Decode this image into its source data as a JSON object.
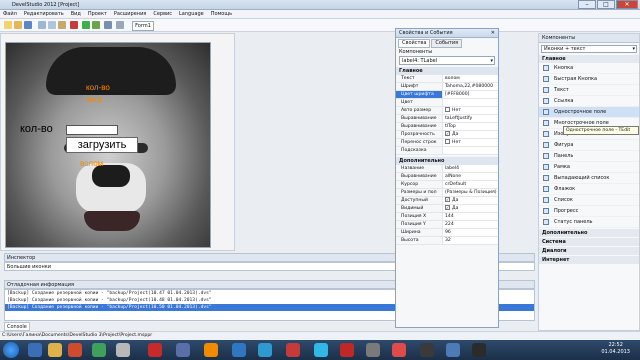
{
  "window": {
    "title": "DevelStudio 2012 [Project]"
  },
  "menu": [
    "Файл",
    "Редактировать",
    "Вид",
    "Проект",
    "Расширения",
    "Сервис",
    "Language",
    "Помощь"
  ],
  "form_tab": "Form1",
  "canvas": {
    "label_text": "кол-во",
    "button_text": "загрузить",
    "orange_label_1": "кол-во",
    "orange_label_2": "загр",
    "orange_label_3": "волом"
  },
  "inspector": {
    "title": "Инспектор",
    "value": "Большие иконки"
  },
  "debug": {
    "title": "Отладочная информация",
    "lines": [
      "[Backup] Создание резервной копии - \"backup/Project(10.47 01.04.2013).dvs\"",
      "[Backup] Создание резервной копии - \"backup/Project(10.48 01.04.2013).dvs\"",
      "[Backup] Создание резервной копии - \"backup/Project(10.50 01.04.2013).dvs\""
    ],
    "console_tab": "Console"
  },
  "path": "C:\\Users\\Галина\\Documents\\DevelStudio 3\\Project\\Project.msppr",
  "props": {
    "title": "Свойства и События",
    "tabs": [
      "Свойства",
      "События"
    ],
    "component_label": "Компоненты",
    "component_value": "label4: TLabel",
    "section_main": "Главное",
    "rows_main": [
      {
        "k": "Текст",
        "v": "волом"
      },
      {
        "k": "Шрифт",
        "v": "Tahoma,22,#080000"
      },
      {
        "k": "Цвет шрифта",
        "v": "[#FF8000]",
        "hl": true
      },
      {
        "k": "Цвет",
        "v": ""
      },
      {
        "k": "Авто размер",
        "v": "Нет",
        "chk": ""
      },
      {
        "k": "Выравнивание",
        "v": "taLeftJustify"
      },
      {
        "k": "Выравнивание",
        "v": "tlTop"
      },
      {
        "k": "Прозрачность",
        "v": "Да",
        "chk": "✓"
      },
      {
        "k": "Перенос строк",
        "v": "Нет",
        "chk": ""
      },
      {
        "k": "Подсказка",
        "v": ""
      }
    ],
    "section_extra": "Дополнительно",
    "rows_extra": [
      {
        "k": "Название",
        "v": "label4"
      },
      {
        "k": "Выравнивание",
        "v": "alNone"
      },
      {
        "k": "Курсор",
        "v": "crDefault"
      },
      {
        "k": "Размеры и пол",
        "v": "(Размеры & Позиция)"
      },
      {
        "k": "Доступный",
        "v": "Да",
        "chk": "✓"
      },
      {
        "k": "Видимый",
        "v": "Да",
        "chk": "✓"
      },
      {
        "k": "Позиция X",
        "v": "144"
      },
      {
        "k": "Позиция Y",
        "v": "224"
      },
      {
        "k": "Ширина",
        "v": "96"
      },
      {
        "k": "Высота",
        "v": "32"
      }
    ]
  },
  "components": {
    "title": "Компоненты",
    "combo": "Иконки + текст",
    "section_main": "Главное",
    "items": [
      "Кнопка",
      "Быстрая Кнопка",
      "Текст",
      "Ссылка",
      "Однострочное поле",
      "Многострочное поле",
      "Изображение",
      "Фигура",
      "Панель",
      "Рамка",
      "Выпадающий список",
      "Флажок",
      "Список",
      "Прогресс",
      "Статус панель"
    ],
    "sections_more": [
      "Дополнительно",
      "Система",
      "Диалоги",
      "Интернет"
    ],
    "tooltip": "Однострочное поле - TEdit"
  },
  "clock": {
    "time": "22:52",
    "date": "01.04.2013"
  }
}
